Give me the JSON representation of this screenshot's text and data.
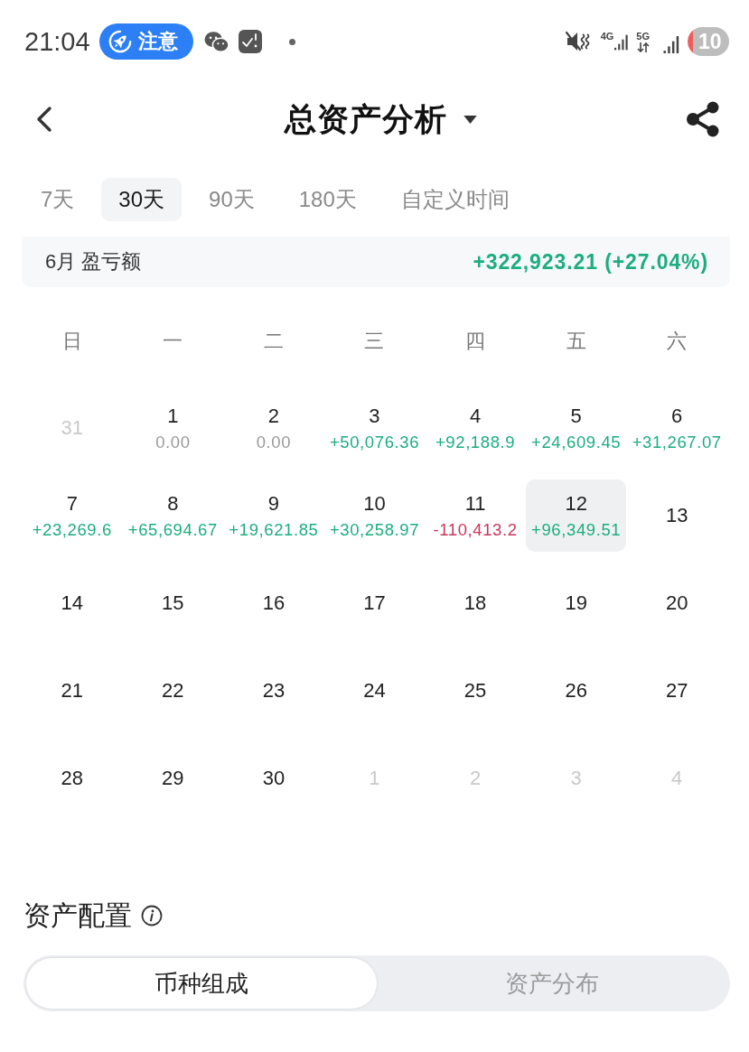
{
  "status_bar": {
    "time": "21:04",
    "notification": "注意",
    "network": [
      {
        "label": "4G",
        "kind": "signal"
      },
      {
        "label": "5G",
        "kind": "data"
      }
    ],
    "battery": "10"
  },
  "header": {
    "title": "总资产分析"
  },
  "tabs": [
    {
      "label": "7天",
      "selected": false
    },
    {
      "label": "30天",
      "selected": true
    },
    {
      "label": "90天",
      "selected": false
    },
    {
      "label": "180天",
      "selected": false
    },
    {
      "label": "自定义时间",
      "selected": false
    }
  ],
  "summary": {
    "label": "6月 盈亏额",
    "value": "+322,923.21 (+27.04%)"
  },
  "calendar": {
    "weekdays": [
      "日",
      "一",
      "二",
      "三",
      "四",
      "五",
      "六"
    ],
    "days": [
      {
        "day": "31",
        "kind": "other_month",
        "selected": false
      },
      {
        "day": "1",
        "kind": "day",
        "pnl": "0.00",
        "color": "#9a9a9a",
        "selected": false
      },
      {
        "day": "2",
        "kind": "day",
        "pnl": "0.00",
        "color": "#9a9a9a",
        "selected": false
      },
      {
        "day": "3",
        "kind": "day",
        "pnl": "+50,076.36",
        "color": "#1cae7c",
        "selected": false
      },
      {
        "day": "4",
        "kind": "day",
        "pnl": "+92,188.9",
        "color": "#1cae7c",
        "selected": false
      },
      {
        "day": "5",
        "kind": "day",
        "pnl": "+24,609.45",
        "color": "#1cae7c",
        "selected": false
      },
      {
        "day": "6",
        "kind": "day",
        "pnl": "+31,267.07",
        "color": "#1cae7c",
        "selected": false
      },
      {
        "day": "7",
        "kind": "day",
        "pnl": "+23,269.6",
        "color": "#1cae7c",
        "selected": false
      },
      {
        "day": "8",
        "kind": "day",
        "pnl": "+65,694.67",
        "color": "#1cae7c",
        "selected": false
      },
      {
        "day": "9",
        "kind": "day",
        "pnl": "+19,621.85",
        "color": "#1cae7c",
        "selected": false
      },
      {
        "day": "10",
        "kind": "day",
        "pnl": "+30,258.97",
        "color": "#1cae7c",
        "selected": false
      },
      {
        "day": "11",
        "kind": "day",
        "pnl": "-110,413.2",
        "color": "#cc3559",
        "selected": false
      },
      {
        "day": "12",
        "kind": "day",
        "pnl": "+96,349.51",
        "color": "#1cae7c",
        "selected": true
      },
      {
        "day": "13",
        "kind": "day",
        "selected": false
      },
      {
        "day": "14",
        "kind": "day",
        "selected": false
      },
      {
        "day": "15",
        "kind": "day",
        "selected": false
      },
      {
        "day": "16",
        "kind": "day",
        "selected": false
      },
      {
        "day": "17",
        "kind": "day",
        "selected": false
      },
      {
        "day": "18",
        "kind": "day",
        "selected": false
      },
      {
        "day": "19",
        "kind": "day",
        "selected": false
      },
      {
        "day": "20",
        "kind": "day",
        "selected": false
      },
      {
        "day": "21",
        "kind": "day",
        "selected": false
      },
      {
        "day": "22",
        "kind": "day",
        "selected": false
      },
      {
        "day": "23",
        "kind": "day",
        "selected": false
      },
      {
        "day": "24",
        "kind": "day",
        "selected": false
      },
      {
        "day": "25",
        "kind": "day",
        "selected": false
      },
      {
        "day": "26",
        "kind": "day",
        "selected": false
      },
      {
        "day": "27",
        "kind": "day",
        "selected": false
      },
      {
        "day": "28",
        "kind": "day",
        "selected": false
      },
      {
        "day": "29",
        "kind": "day",
        "selected": false
      },
      {
        "day": "30",
        "kind": "day",
        "selected": false
      },
      {
        "day": "1",
        "kind": "other_month",
        "selected": false
      },
      {
        "day": "2",
        "kind": "other_month",
        "selected": false
      },
      {
        "day": "3",
        "kind": "other_month",
        "selected": false
      },
      {
        "day": "4",
        "kind": "other_month",
        "selected": false
      }
    ]
  },
  "allocation": {
    "title": "资产配置",
    "segments": [
      {
        "label": "币种组成",
        "selected": true
      },
      {
        "label": "资产分布",
        "selected": false
      }
    ]
  }
}
